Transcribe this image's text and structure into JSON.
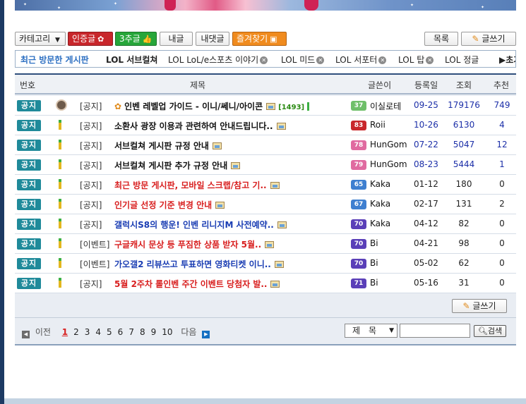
{
  "toolbar": {
    "category_label": "카테고리",
    "category_arrow": "▼",
    "certified_label": "인증글",
    "upvoted_label": "3추글",
    "my_posts_label": "내글",
    "my_comments_label": "내댓글",
    "favorites_label": "즐겨찾기",
    "list_label": "목록",
    "write_label": "글쓰기"
  },
  "recent_boards": {
    "label": "최근 방문한 게시판",
    "items": [
      "LOL 서브컬쳐",
      "LOL LoL/e스포츠 이야기",
      "LOL 미드",
      "LOL 서포터",
      "LOL 탑",
      "LOL 정글"
    ],
    "more_label": "▶초기화"
  },
  "table": {
    "headers": {
      "no": "번호",
      "title": "제목",
      "author": "글쓴이",
      "date": "등록일",
      "views": "조회",
      "recommend": "추천"
    },
    "rows": [
      {
        "badge": "공지",
        "category": "[공지]",
        "title": "인벤 레벨업 가이드 - 이니/쎄니/아이콘",
        "comment_count": "[1493]",
        "title_color": "black",
        "level": "37",
        "level_color": "#6fbf6a",
        "author": "이실로테",
        "date": "09-25",
        "views": "179176",
        "recommend": "749",
        "value_color": "blue",
        "avatar": true,
        "has_image": true
      },
      {
        "badge": "공지",
        "category": "[공지]",
        "title": "소환사 광장 이용과 관련하여 안내드립니다..",
        "comment_count": "",
        "title_color": "black",
        "level": "83",
        "level_color": "#c8262b",
        "author": "Roii",
        "date": "10-26",
        "views": "6130",
        "recommend": "4",
        "value_color": "blue",
        "avatar": false,
        "has_image": true
      },
      {
        "badge": "공지",
        "category": "[공지]",
        "title": "서브컬쳐 게시판 규정 안내",
        "comment_count": "",
        "title_color": "black",
        "level": "78",
        "level_color": "#e06aa0",
        "author": "HunGom",
        "date": "07-22",
        "views": "5047",
        "recommend": "12",
        "value_color": "blue",
        "avatar": false,
        "has_image": true
      },
      {
        "badge": "공지",
        "category": "[공지]",
        "title": "서브컬쳐 게시판 추가 규정 안내",
        "comment_count": "",
        "title_color": "black",
        "level": "79",
        "level_color": "#e06aa0",
        "author": "HunGom",
        "date": "08-23",
        "views": "5444",
        "recommend": "1",
        "value_color": "blue",
        "avatar": false,
        "has_image": true
      },
      {
        "badge": "공지",
        "category": "[공지]",
        "title": "최근 방문 게시판, 모바일 스크랩/참고 기..",
        "comment_count": "",
        "title_color": "red",
        "level": "65",
        "level_color": "#3e7fd0",
        "author": "Kaka",
        "date": "01-12",
        "views": "180",
        "recommend": "0",
        "value_color": "black",
        "avatar": false,
        "has_image": true
      },
      {
        "badge": "공지",
        "category": "[공지]",
        "title": "인기글 선정 기준 변경 안내",
        "comment_count": "",
        "title_color": "red",
        "level": "67",
        "level_color": "#3e7fd0",
        "author": "Kaka",
        "date": "02-17",
        "views": "131",
        "recommend": "2",
        "value_color": "black",
        "avatar": false,
        "has_image": true
      },
      {
        "badge": "공지",
        "category": "[공지]",
        "title": "갤럭시S8의 행운! 인벤 리니지M 사전예약..",
        "comment_count": "",
        "title_color": "blue",
        "level": "70",
        "level_color": "#5a3fb8",
        "author": "Kaka",
        "date": "04-12",
        "views": "82",
        "recommend": "0",
        "value_color": "black",
        "avatar": false,
        "has_image": true
      },
      {
        "badge": "공지",
        "category": "[이벤트]",
        "title": "구글캐시 문상 등 푸짐한 상품 받자 5월..",
        "comment_count": "",
        "title_color": "red",
        "level": "70",
        "level_color": "#5a3fb8",
        "author": "Bi",
        "date": "04-21",
        "views": "98",
        "recommend": "0",
        "value_color": "black",
        "avatar": false,
        "has_image": true
      },
      {
        "badge": "공지",
        "category": "[이벤트]",
        "title": "가오갤2 리뷰쓰고 투표하면 영화티켓 이니..",
        "comment_count": "",
        "title_color": "blue",
        "level": "70",
        "level_color": "#5a3fb8",
        "author": "Bi",
        "date": "05-02",
        "views": "62",
        "recommend": "0",
        "value_color": "black",
        "avatar": false,
        "has_image": true
      },
      {
        "badge": "공지",
        "category": "[공지]",
        "title": "5월 2주차 롤인벤 주간 이벤트 당첨자 발..",
        "comment_count": "",
        "title_color": "red",
        "level": "71",
        "level_color": "#5a3fb8",
        "author": "Bi",
        "date": "05-16",
        "views": "31",
        "recommend": "0",
        "value_color": "black",
        "avatar": false,
        "has_image": true
      }
    ]
  },
  "pagination": {
    "prev_label": "이전",
    "next_label": "다음",
    "pages": [
      "1",
      "2",
      "3",
      "4",
      "5",
      "6",
      "7",
      "8",
      "9",
      "10"
    ],
    "current": "1"
  },
  "search": {
    "field_label": "제　목",
    "field_arrow": "▼",
    "input_value": "",
    "button_label": "검색"
  }
}
